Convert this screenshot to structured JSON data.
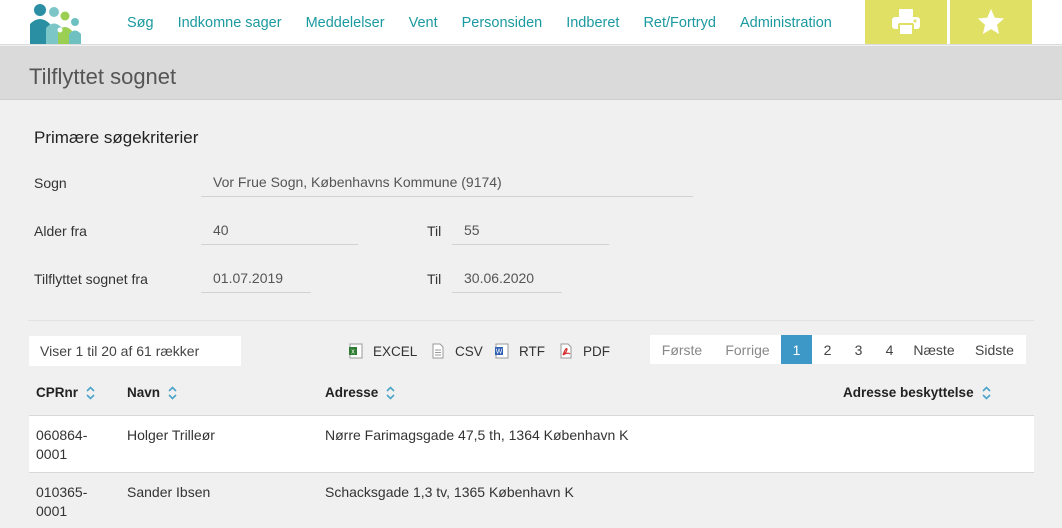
{
  "nav": {
    "items": [
      "Søg",
      "Indkomne sager",
      "Meddelelser",
      "Vent",
      "Personsiden",
      "Indberet",
      "Ret/Fortryd",
      "Administration"
    ]
  },
  "toolbar": {
    "print_icon": "print-icon",
    "favorite_icon": "star-icon"
  },
  "colors": {
    "accent": "#1b9aa0",
    "tool_bg": "#dfe064",
    "pager_active": "#3d97c7"
  },
  "page": {
    "title": "Tilflyttet sognet"
  },
  "criteria": {
    "heading": "Primære søgekriterier",
    "sogn_label": "Sogn",
    "sogn_value": "Vor Frue Sogn, Københavns Kommune (9174)",
    "alder_label": "Alder fra",
    "alder_fra": "40",
    "alder_til_label": "Til",
    "alder_til": "55",
    "tilflyttet_label": "Tilflyttet sognet fra",
    "tilflyttet_fra": "01.07.2019",
    "tilflyttet_til_label": "Til",
    "tilflyttet_til": "30.06.2020"
  },
  "results": {
    "rowcount": "Viser 1 til 20 af 61 rækker",
    "exports": [
      "EXCEL",
      "CSV",
      "RTF",
      "PDF"
    ],
    "pager": {
      "first": "Første",
      "prev": "Forrige",
      "pages": [
        "1",
        "2",
        "3",
        "4"
      ],
      "next": "Næste",
      "last": "Sidste",
      "current": "1"
    },
    "columns": [
      "CPRnr",
      "Navn",
      "Adresse",
      "Adresse beskyttelse"
    ],
    "rows": [
      {
        "cpr": "060864-\n0001",
        "navn": "Holger Trilleør",
        "adresse": "Nørre Farimagsgade 47,5 th, 1364 København K",
        "beskyttelse": ""
      },
      {
        "cpr": "010365-\n0001",
        "navn": "Sander Ibsen",
        "adresse": "Schacksgade 1,3 tv, 1365 København K",
        "beskyttelse": ""
      }
    ]
  }
}
